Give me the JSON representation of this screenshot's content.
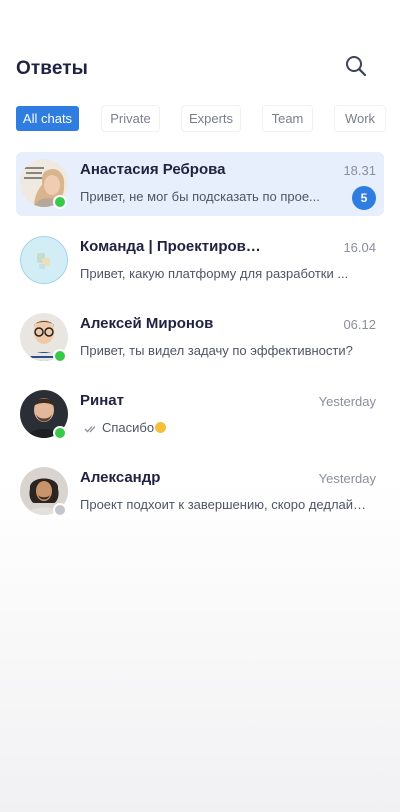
{
  "header": {
    "title": "Ответы",
    "search_icon": "search-icon"
  },
  "tabs": [
    {
      "label": "All chats",
      "active": true
    },
    {
      "label": "Private",
      "active": false
    },
    {
      "label": "Experts",
      "active": false
    },
    {
      "label": "Team",
      "active": false
    },
    {
      "label": "Work",
      "active": false
    }
  ],
  "chats": [
    {
      "name": "Анастасия Реброва",
      "time": "18.31",
      "preview": "Привет, не мог бы подсказать по прое...",
      "unread": "5",
      "status": "online",
      "selected": true
    },
    {
      "name": "Команда | Проектирование ин...",
      "time": "16.04",
      "preview": "Привет, какую платформу для разработки ...",
      "status": "none",
      "selected": false
    },
    {
      "name": "Алексей Миронов",
      "time": "06.12",
      "preview": "Привет, ты видел задачу по эффективности?",
      "status": "online",
      "selected": false
    },
    {
      "name": "Ринат",
      "time": "Yesterday",
      "preview": "Спасибо",
      "read_receipt": "double-check-icon",
      "status": "online",
      "selected": false
    },
    {
      "name": "Александр",
      "time": "Yesterday",
      "preview": "Проект подхоит к завершению, скоро дедлайн ...",
      "status": "offline",
      "selected": false
    }
  ],
  "colors": {
    "accent": "#2f7de1",
    "online": "#36c94a",
    "offline": "#c4c6cc",
    "selected_row": "#e6effb"
  }
}
